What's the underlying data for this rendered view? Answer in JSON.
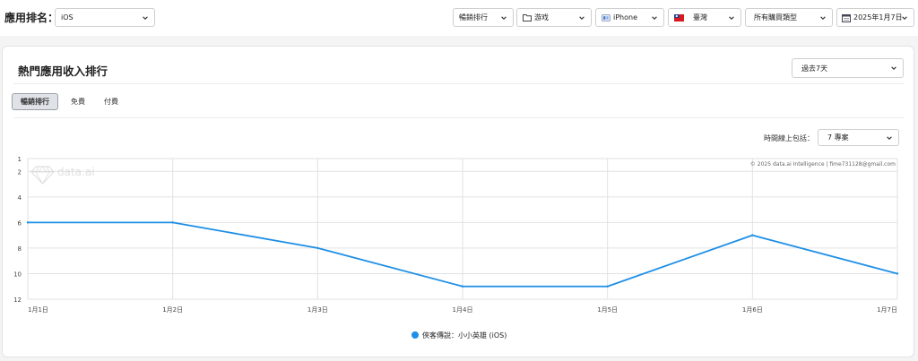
{
  "header": {
    "app_label": "應用排名：",
    "platform_select": "iOS",
    "rank_type_select": "暢銷排行",
    "category_select": "游戏",
    "device_select": "iPhone",
    "country_select": "臺灣",
    "purchase_type_select": "所有購買類型",
    "date_select": "2025年1月7日"
  },
  "card": {
    "title": "熱門應用收入排行",
    "period_select": "過去7天",
    "tabs": [
      {
        "label": "暢銷排行",
        "active": true
      },
      {
        "label": "免費",
        "active": false
      },
      {
        "label": "付費",
        "active": false
      }
    ],
    "include_label": "時間線上包括：",
    "include_select": "7 專案"
  },
  "chart_data": {
    "type": "line",
    "categories": [
      "1月1日",
      "1月2日",
      "1月3日",
      "1月4日",
      "1月5日",
      "1月6日",
      "1月7日"
    ],
    "series": [
      {
        "name": "俠客傳說：小小英雄 (iOS)",
        "values": [
          6,
          6,
          8,
          11,
          11,
          7,
          10
        ],
        "color": "#1e8fe6"
      }
    ],
    "y_ticks": [
      1,
      2,
      4,
      6,
      8,
      10,
      12
    ],
    "ylim": [
      1,
      12
    ],
    "y_reversed": true,
    "grid": true,
    "legend_position": "bottom-center",
    "watermark_logo": "data.ai",
    "copyright": "© 2025 data.ai Intelligence | fime731128@gmail.com"
  }
}
